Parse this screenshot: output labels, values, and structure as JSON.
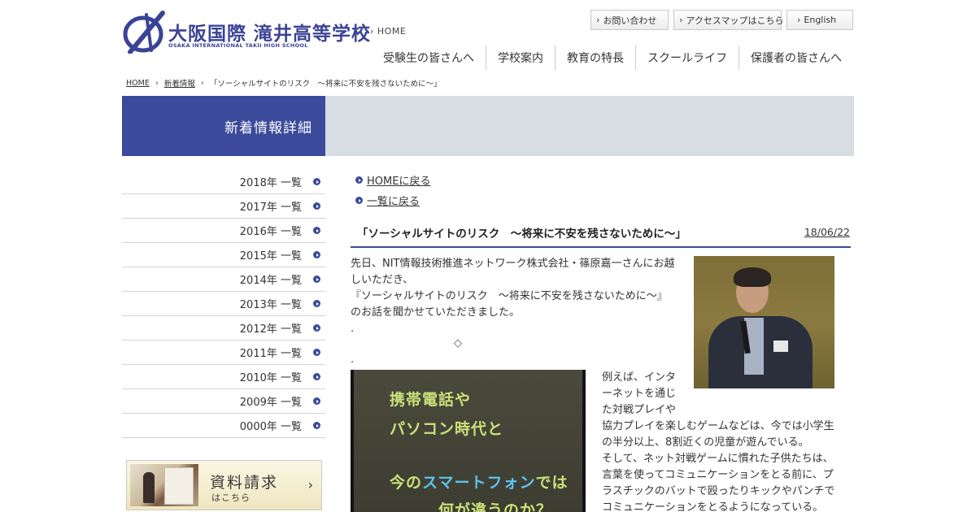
{
  "header": {
    "logo_text": "大阪国際 滝井高等学校",
    "logo_sub": "OSAKA INTERNATIONAL TAKII HIGH SCHOOL",
    "home_link": "HOME",
    "util_buttons": [
      "お問い合わせ",
      "アクセスマップはこちら",
      "English"
    ],
    "nav": [
      "受験生の皆さんへ",
      "学校案内",
      "教育の特長",
      "スクールライフ",
      "保護者の皆さんへ"
    ]
  },
  "breadcrumb": [
    "HOME",
    "新着情報",
    "「ソーシャルサイトのリスク　～将来に不安を残さないために～」"
  ],
  "band_title": "新着情報詳細",
  "sidebar": {
    "years": [
      "2018年 一覧",
      "2017年 一覧",
      "2016年 一覧",
      "2015年 一覧",
      "2014年 一覧",
      "2013年 一覧",
      "2012年 一覧",
      "2011年 一覧",
      "2010年 一覧",
      "2009年 一覧",
      "0000年 一覧"
    ],
    "request_title": "資料請求",
    "request_sub": "はこちら"
  },
  "main": {
    "back_home": "HOMEに戻る",
    "back_list": "一覧に戻る",
    "title": "「ソーシャルサイトのリスク　～将来に不安を残さないために～」",
    "date": "18/06/22",
    "para1": [
      "先日、NIT情報技術推進ネットワーク株式会社・篠原嘉一さんにお越",
      "しいただき、",
      "『ソーシャルサイトのリスク　～将来に不安を残さないために～』",
      "のお話を聞かせていただきました。",
      "."
    ],
    "diamond": "◇",
    "dot": ".",
    "para2": [
      "例えば、インタ",
      "ーネットを通じ",
      "た対戦プレイや",
      "協力プレイを楽しむゲームなどは、今では小学生",
      "の半分以上、8割近くの児童が遊んでいる。",
      "そして、ネット対戦ゲームに慣れた子供たちは、",
      "言葉を使ってコミュニケーションをとる前に、プ",
      "ラスチックのバットで殴ったりキックやパンチで",
      "コミュニケーションをとるようになっている。"
    ],
    "slide_lines": [
      "携帯電話や",
      "パソコン時代と",
      "今の",
      "スマートフォン",
      "では",
      "何が違うのか？"
    ]
  }
}
